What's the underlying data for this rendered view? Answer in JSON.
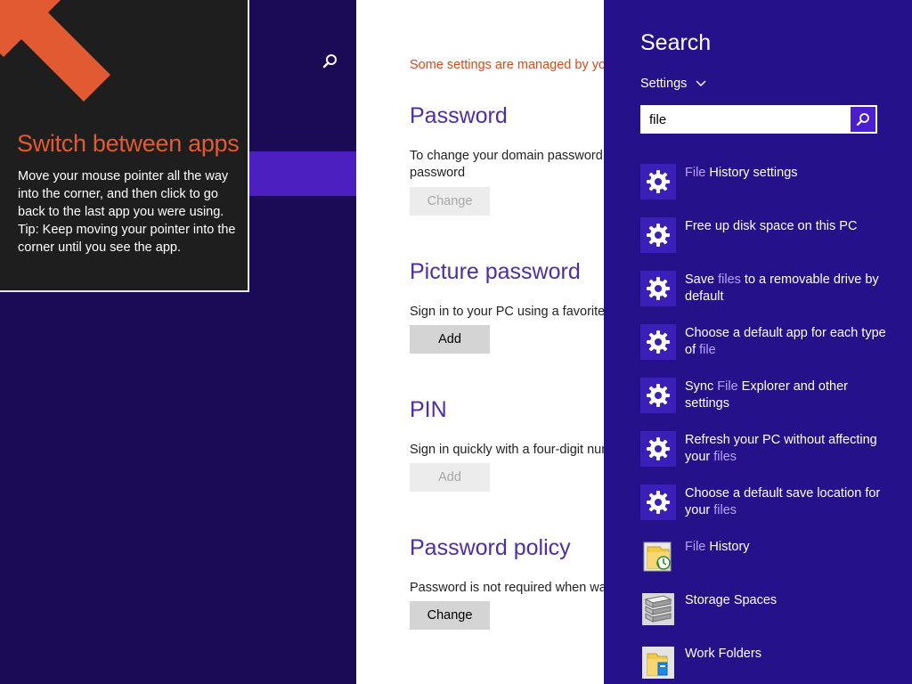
{
  "tip": {
    "title": "Switch between apps",
    "body_line1": "Move your mouse pointer all the way into the corner, and then click to go back to the last app you were using.",
    "body_line2": "Tip: Keep moving your pointer into the corner until you see the app."
  },
  "settings": {
    "managed_notice": "Some settings are managed by yo",
    "password": {
      "title": "Password",
      "desc": "To change your domain password, password",
      "button": "Change"
    },
    "picture_password": {
      "title": "Picture password",
      "desc": "Sign in to your PC using a favorite",
      "button": "Add"
    },
    "pin": {
      "title": "PIN",
      "desc": "Sign in quickly with a four-digit nur",
      "button": "Add"
    },
    "policy": {
      "title": "Password policy",
      "desc": "Password is not required when wak",
      "button": "Change"
    }
  },
  "search": {
    "title": "Search",
    "scope": "Settings",
    "query": "file",
    "results": [
      {
        "pre": "",
        "hl": "File",
        "post": " History settings",
        "icon": "gear-icon"
      },
      {
        "pre": "Free up disk space on this PC",
        "hl": "",
        "post": "",
        "icon": "gear-icon"
      },
      {
        "pre": "Save ",
        "hl": "files",
        "post": " to a removable drive by default",
        "icon": "gear-icon"
      },
      {
        "pre": "Choose a default app for each type of ",
        "hl": "file",
        "post": "",
        "icon": "gear-icon"
      },
      {
        "pre": "Sync ",
        "hl": "File",
        "post": " Explorer and other settings",
        "icon": "gear-icon"
      },
      {
        "pre": "Refresh your PC without affecting your ",
        "hl": "files",
        "post": "",
        "icon": "gear-icon"
      },
      {
        "pre": "Choose a default save location for your ",
        "hl": "files",
        "post": "",
        "icon": "gear-icon"
      },
      {
        "pre": "",
        "hl": "File",
        "post": " History",
        "icon": "file-history-icon"
      },
      {
        "pre": "Storage Spaces",
        "hl": "",
        "post": "",
        "icon": "storage-spaces-icon"
      },
      {
        "pre": "Work Folders",
        "hl": "",
        "post": "",
        "icon": "work-folders-icon"
      }
    ]
  },
  "colors": {
    "app_background": "#1b0b57",
    "charm_background": "#25118a",
    "accent": "#4b2ea8",
    "highlight": "#b7a3ff",
    "tip_title": "#e15a32"
  }
}
